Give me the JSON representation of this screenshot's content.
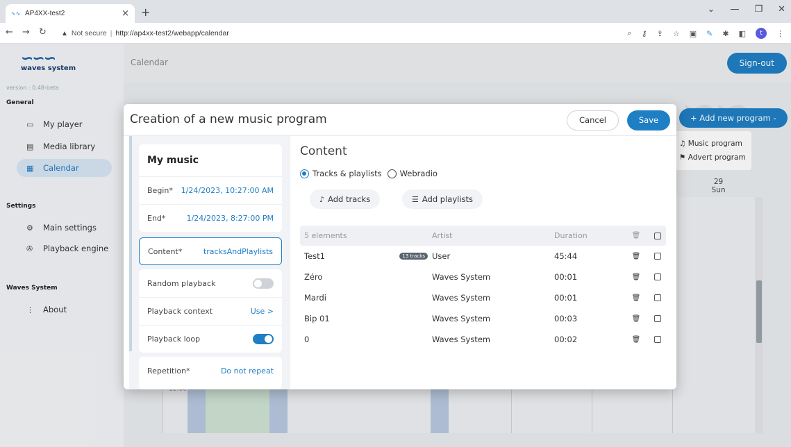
{
  "browser": {
    "tab_title": "AP4XX-test2",
    "tab_close": "×",
    "new_tab": "+",
    "not_secure": "Not secure",
    "url_sep": "|",
    "url": "http://ap4xx-test2/webapp/calendar",
    "profile_initial": "t"
  },
  "sidebar": {
    "logo_text": "waves system",
    "version": "version : 0.48-beta",
    "section_general": "General",
    "section_settings": "Settings",
    "section_waves": "Waves System",
    "items": {
      "player": "My player",
      "media": "Media library",
      "calendar": "Calendar",
      "main_settings": "Main settings",
      "playback_engine": "Playback engine",
      "about": "About"
    }
  },
  "topbar": {
    "crumb": "Calendar",
    "signout": "Sign-out"
  },
  "calendar": {
    "add_program": "+ Add new program -",
    "menu": [
      "Music program",
      "Advert program"
    ],
    "day_num": "29",
    "day_name": "Sun",
    "time": "12:00"
  },
  "modal": {
    "title": "Creation of a new music program",
    "cancel": "Cancel",
    "save": "Save",
    "left": {
      "card_title": "My music",
      "begin_label": "Begin*",
      "begin_value": "1/24/2023, 10:27:00 AM",
      "end_label": "End*",
      "end_value": "1/24/2023, 8:27:00 PM",
      "content_label": "Content*",
      "content_value": "tracksAndPlaylists",
      "random_label": "Random playback",
      "random_on": false,
      "context_label": "Playback context",
      "context_value": "Use >",
      "loop_label": "Playback loop",
      "loop_on": true,
      "repetition_label": "Repetition*",
      "repetition_value": "Do not repeat"
    },
    "right": {
      "content_title": "Content",
      "radio_tracks": "Tracks & playlists",
      "radio_webradio": "Webradio",
      "selected": "tracks",
      "add_tracks": "Add tracks",
      "add_playlists": "Add playlists",
      "table": {
        "headers": {
          "count": "5 elements",
          "artist": "Artist",
          "duration": "Duration"
        },
        "rows": [
          {
            "name": "Test1",
            "badge": "13 tracks",
            "artist": "User",
            "duration": "45:44"
          },
          {
            "name": "Zéro",
            "badge": "",
            "artist": "Waves System",
            "duration": "00:01"
          },
          {
            "name": "Mardi",
            "badge": "",
            "artist": "Waves System",
            "duration": "00:01"
          },
          {
            "name": "Bip 01",
            "badge": "",
            "artist": "Waves System",
            "duration": "00:03"
          },
          {
            "name": "0",
            "badge": "",
            "artist": "Waves System",
            "duration": "00:02"
          }
        ]
      }
    }
  },
  "colors": {
    "accent": "#1f7fc4",
    "active_nav_bg": "#d7e6f4"
  }
}
